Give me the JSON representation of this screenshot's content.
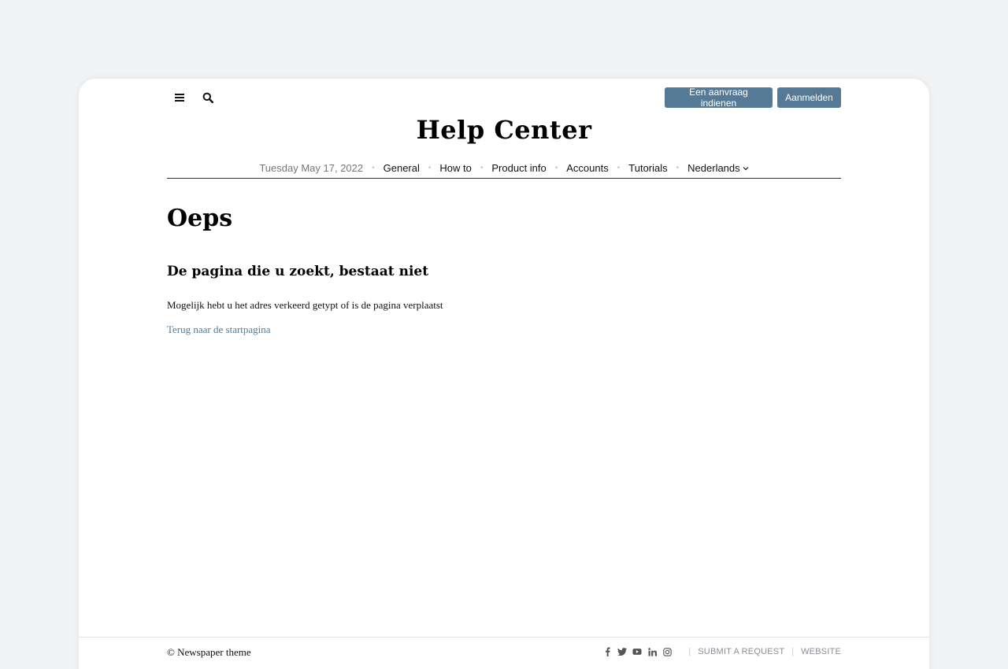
{
  "header": {
    "request_label": "Een aanvraag indienen",
    "signin_label": "Aanmelden",
    "site_title": "Help Center"
  },
  "nav": {
    "date": "Tuesday May 17, 2022",
    "items": [
      "General",
      "How to",
      "Product info",
      "Accounts",
      "Tutorials"
    ],
    "language": "Nederlands"
  },
  "main": {
    "heading": "Oeps",
    "subheading": "De pagina die u zoekt, bestaat niet",
    "message": "Mogelijk hebt u het adres verkeerd getypt of is de pagina verplaatst",
    "back_link": "Terug naar de startpagina"
  },
  "footer": {
    "copyright": "© Newspaper theme",
    "social_icons": [
      "facebook-icon",
      "twitter-icon",
      "youtube-icon",
      "linkedin-icon",
      "instagram-icon"
    ],
    "submit_request": "SUBMIT A REQUEST",
    "website": "WEBSITE"
  },
  "colors": {
    "accent": "#557a95",
    "background": "#f1f2f4"
  }
}
